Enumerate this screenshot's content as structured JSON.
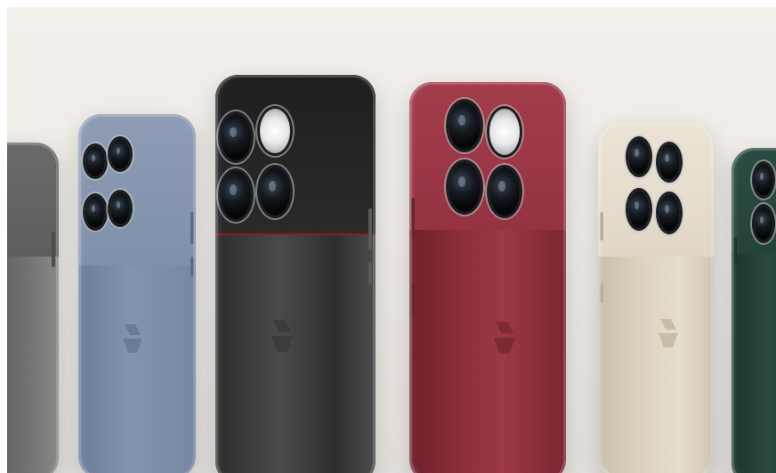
{
  "scene": {
    "description_free": true,
    "background_color": "#efece8",
    "phones": [
      {
        "id": "phone-gray",
        "body_color": "#6d6d6b",
        "module_color": "#5f5f5d"
      },
      {
        "id": "phone-blue",
        "body_color": "#7b8ca6",
        "module_color": "#8797b0"
      },
      {
        "id": "phone-black",
        "body_color": "#3a3a3a",
        "module_color": "#2a2a2a"
      },
      {
        "id": "phone-red",
        "body_color": "#8c2d3c",
        "module_color": "#9a3545"
      },
      {
        "id": "phone-champagne",
        "body_color": "#d8cfbd",
        "module_color": "#e4dccb"
      },
      {
        "id": "phone-green",
        "body_color": "#1f3b33",
        "module_color": "#25463d"
      }
    ],
    "icons": [
      "camera-lens-icon",
      "flash-icon",
      "brand-logo-icon"
    ]
  }
}
